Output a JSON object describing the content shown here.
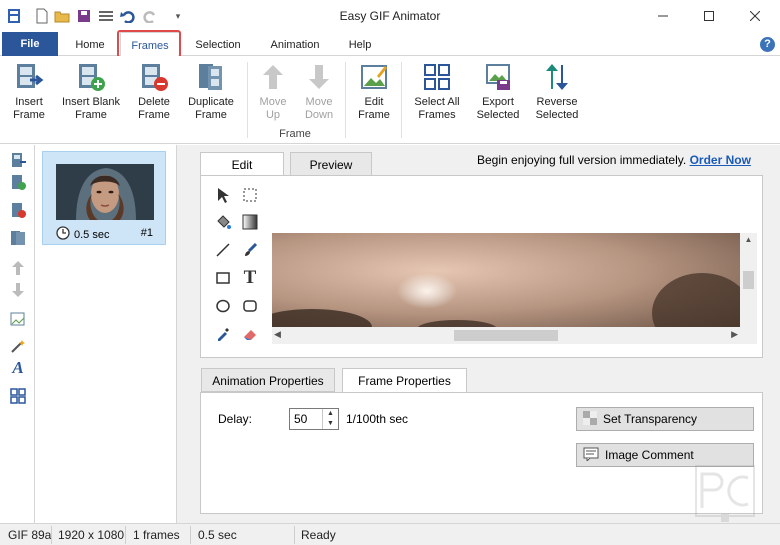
{
  "window": {
    "title": "Easy GIF Animator"
  },
  "ribbon_tabs": [
    "File",
    "Home",
    "Frames",
    "Selection",
    "Animation",
    "Help"
  ],
  "help_glyph": "?",
  "ribbon": {
    "group_label": "Frame",
    "buttons": [
      {
        "label": "Insert\nFrame",
        "icon": "insert-frame-icon",
        "enabled": true
      },
      {
        "label": "Insert Blank\nFrame",
        "icon": "insert-blank-frame-icon",
        "enabled": true
      },
      {
        "label": "Delete\nFrame",
        "icon": "delete-frame-icon",
        "enabled": true
      },
      {
        "label": "Duplicate\nFrame",
        "icon": "duplicate-frame-icon",
        "enabled": true
      },
      {
        "label": "Move\nUp",
        "icon": "arrow-up-icon",
        "enabled": false
      },
      {
        "label": "Move\nDown",
        "icon": "arrow-down-icon",
        "enabled": false
      },
      {
        "label": "Edit\nFrame",
        "icon": "edit-frame-icon",
        "enabled": true
      },
      {
        "label": "Select All\nFrames",
        "icon": "select-all-icon",
        "enabled": true
      },
      {
        "label": "Export\nSelected",
        "icon": "export-icon",
        "enabled": true
      },
      {
        "label": "Reverse\nSelected",
        "icon": "reverse-icon",
        "enabled": true
      }
    ]
  },
  "frame_list": [
    {
      "delay": "0.5 sec",
      "number": "#1"
    }
  ],
  "editor": {
    "tabs": [
      "Edit",
      "Preview"
    ],
    "promo_text": "Begin enjoying full version immediately.",
    "promo_link": "Order Now"
  },
  "properties": {
    "tabs": [
      "Animation Properties",
      "Frame Properties"
    ],
    "delay_label": "Delay:",
    "delay_value": "50",
    "delay_unit": "1/100th sec",
    "set_transparency": "Set Transparency",
    "image_comment": "Image Comment"
  },
  "status": {
    "format": "GIF 89a",
    "dimensions": "1920 x 1080",
    "frames": "1 frames",
    "duration": "0.5 sec",
    "state": "Ready"
  },
  "colors": {
    "accent": "#2b579a",
    "highlight": "#e04a4a",
    "selection": "#cde5f7",
    "link": "#1a5ab8"
  }
}
